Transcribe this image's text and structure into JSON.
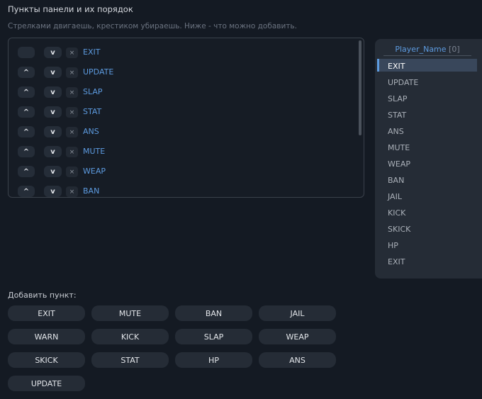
{
  "header": {
    "title": "Пункты панели и их порядок",
    "hint": "Стрелками двигаешь, крестиком убираешь. Ниже - что можно добавить."
  },
  "controls": {
    "up_label": "^",
    "down_label": "v",
    "remove_label": "×"
  },
  "order_list": {
    "items": [
      "EXIT",
      "UPDATE",
      "SLAP",
      "STAT",
      "ANS",
      "MUTE",
      "WEAP",
      "BAN"
    ]
  },
  "preview": {
    "player_name": "Player_Name",
    "player_id": "[0]",
    "items": [
      "EXIT",
      "UPDATE",
      "SLAP",
      "STAT",
      "ANS",
      "MUTE",
      "WEAP",
      "BAN",
      "JAIL",
      "KICK",
      "SKICK",
      "HP",
      "EXIT"
    ],
    "active_index": 0
  },
  "add_section": {
    "label": "Добавить пункт:",
    "buttons": [
      "EXIT",
      "MUTE",
      "BAN",
      "JAIL",
      "WARN",
      "KICK",
      "SLAP",
      "WEAP",
      "SKICK",
      "STAT",
      "HP",
      "ANS",
      "UPDATE"
    ]
  },
  "colors": {
    "accent": "#5d9be0",
    "background": "#141a23",
    "button": "#252c36"
  }
}
